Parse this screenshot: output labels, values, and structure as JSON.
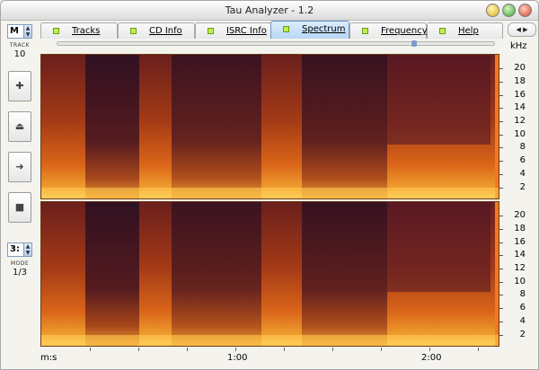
{
  "window": {
    "title": "Tau Analyzer - 1.2"
  },
  "side": {
    "mode_select": "M",
    "track_caption": "TRACK",
    "track_number": "10",
    "buttons": [
      {
        "name": "add-button",
        "glyph": "✚"
      },
      {
        "name": "eject-button",
        "glyph": "⏏"
      },
      {
        "name": "next-button",
        "glyph": "➜"
      },
      {
        "name": "stop-button",
        "glyph": "■"
      }
    ],
    "mode_value_select": "3:",
    "mode_caption": "MODE",
    "mode_value": "1/3"
  },
  "tabs": [
    {
      "id": "tracks",
      "label": "Tracks",
      "active": false
    },
    {
      "id": "cd-info",
      "label": "CD Info",
      "active": false
    },
    {
      "id": "isrc-info",
      "label": "ISRC Info",
      "active": false
    },
    {
      "id": "spectrum",
      "label": "Spectrum",
      "active": true
    },
    {
      "id": "frequency",
      "label": "Frequency",
      "active": false
    },
    {
      "id": "help",
      "label": "Help",
      "active": false
    }
  ],
  "tab_scroll": "◀ ▶",
  "spectrum": {
    "freq_unit": "kHz",
    "freq_ticks": [
      "20",
      "18",
      "16",
      "14",
      "12",
      "10",
      "8",
      "6",
      "4",
      "2"
    ],
    "time_unit": "m:s",
    "time_labels": [
      "1:00",
      "2:00"
    ],
    "colors": {
      "hot": "#ffd24a",
      "mid": "#e07018",
      "cool": "#8a2a14",
      "dark": "#2a0f20"
    }
  }
}
